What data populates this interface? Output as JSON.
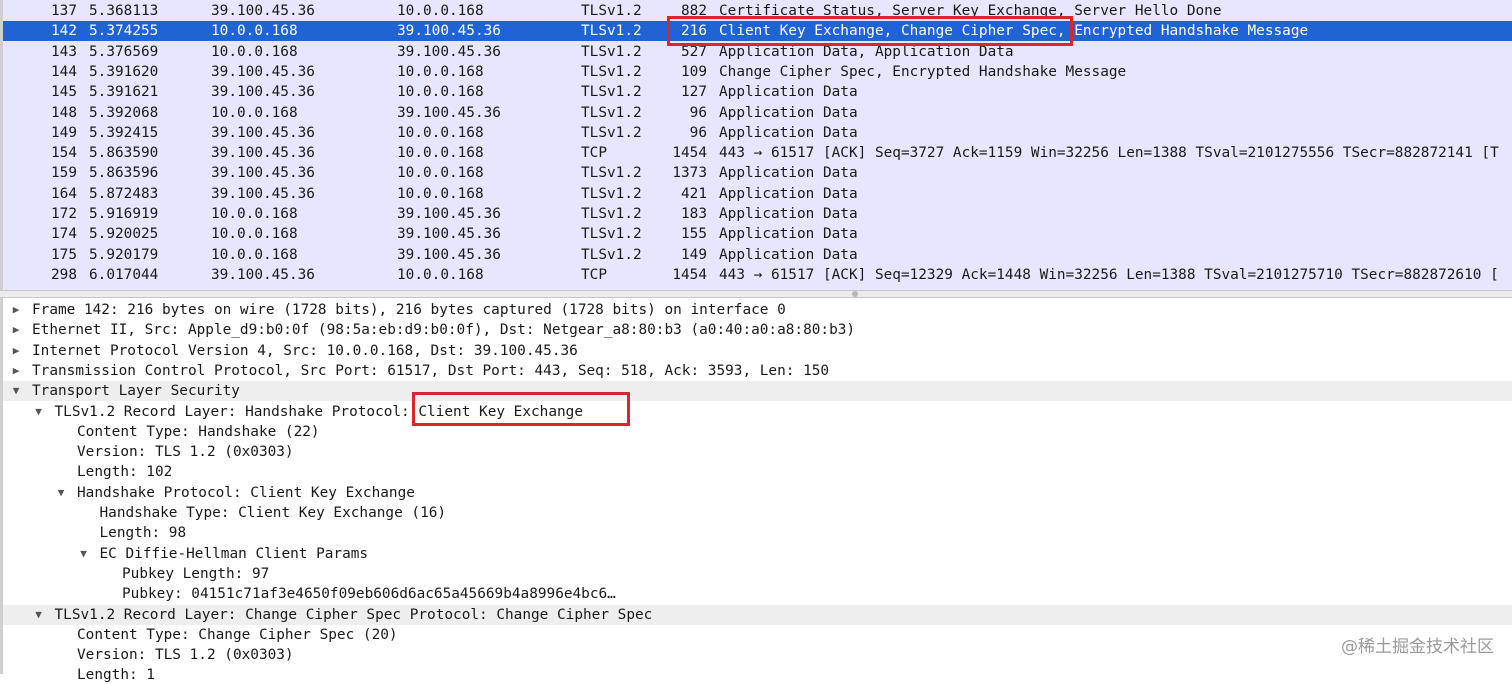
{
  "packets": [
    {
      "no": "137",
      "time": "5.368113",
      "src": "39.100.45.36",
      "dst": "10.0.0.168",
      "proto": "TLSv1.2",
      "len": "882",
      "info": "Certificate Status, Server Key Exchange, Server Hello Done"
    },
    {
      "no": "142",
      "time": "5.374255",
      "src": "10.0.0.168",
      "dst": "39.100.45.36",
      "proto": "TLSv1.2",
      "len": "216",
      "info": "Client Key Exchange, Change Cipher Spec, Encrypted Handshake Message"
    },
    {
      "no": "143",
      "time": "5.376569",
      "src": "10.0.0.168",
      "dst": "39.100.45.36",
      "proto": "TLSv1.2",
      "len": "527",
      "info": "Application Data, Application Data"
    },
    {
      "no": "144",
      "time": "5.391620",
      "src": "39.100.45.36",
      "dst": "10.0.0.168",
      "proto": "TLSv1.2",
      "len": "109",
      "info": "Change Cipher Spec, Encrypted Handshake Message"
    },
    {
      "no": "145",
      "time": "5.391621",
      "src": "39.100.45.36",
      "dst": "10.0.0.168",
      "proto": "TLSv1.2",
      "len": "127",
      "info": "Application Data"
    },
    {
      "no": "148",
      "time": "5.392068",
      "src": "10.0.0.168",
      "dst": "39.100.45.36",
      "proto": "TLSv1.2",
      "len": "96",
      "info": "Application Data"
    },
    {
      "no": "149",
      "time": "5.392415",
      "src": "39.100.45.36",
      "dst": "10.0.0.168",
      "proto": "TLSv1.2",
      "len": "96",
      "info": "Application Data"
    },
    {
      "no": "154",
      "time": "5.863590",
      "src": "39.100.45.36",
      "dst": "10.0.0.168",
      "proto": "TCP",
      "len": "1454",
      "info": "443 → 61517 [ACK] Seq=3727 Ack=1159 Win=32256 Len=1388 TSval=2101275556 TSecr=882872141 [T"
    },
    {
      "no": "159",
      "time": "5.863596",
      "src": "39.100.45.36",
      "dst": "10.0.0.168",
      "proto": "TLSv1.2",
      "len": "1373",
      "info": "Application Data"
    },
    {
      "no": "164",
      "time": "5.872483",
      "src": "39.100.45.36",
      "dst": "10.0.0.168",
      "proto": "TLSv1.2",
      "len": "421",
      "info": "Application Data"
    },
    {
      "no": "172",
      "time": "5.916919",
      "src": "10.0.0.168",
      "dst": "39.100.45.36",
      "proto": "TLSv1.2",
      "len": "183",
      "info": "Application Data"
    },
    {
      "no": "174",
      "time": "5.920025",
      "src": "10.0.0.168",
      "dst": "39.100.45.36",
      "proto": "TLSv1.2",
      "len": "155",
      "info": "Application Data"
    },
    {
      "no": "175",
      "time": "5.920179",
      "src": "10.0.0.168",
      "dst": "39.100.45.36",
      "proto": "TLSv1.2",
      "len": "149",
      "info": "Application Data"
    },
    {
      "no": "298",
      "time": "6.017044",
      "src": "39.100.45.36",
      "dst": "10.0.0.168",
      "proto": "TCP",
      "len": "1454",
      "info": "443 → 61517 [ACK] Seq=12329 Ack=1448 Win=32256 Len=1388 TSval=2101275710 TSecr=882872610 ["
    }
  ],
  "details": [
    {
      "indent": 0,
      "state": "collapsed",
      "text": "Frame 142: 216 bytes on wire (1728 bits), 216 bytes captured (1728 bits) on interface 0"
    },
    {
      "indent": 0,
      "state": "collapsed",
      "text": "Ethernet II, Src: Apple_d9:b0:0f (98:5a:eb:d9:b0:0f), Dst: Netgear_a8:80:b3 (a0:40:a0:a8:80:b3)"
    },
    {
      "indent": 0,
      "state": "collapsed",
      "text": "Internet Protocol Version 4, Src: 10.0.0.168, Dst: 39.100.45.36"
    },
    {
      "indent": 0,
      "state": "collapsed",
      "text": "Transmission Control Protocol, Src Port: 61517, Dst Port: 443, Seq: 518, Ack: 3593, Len: 150"
    },
    {
      "indent": 0,
      "state": "expanded",
      "text": "Transport Layer Security",
      "alt": true
    },
    {
      "indent": 1,
      "state": "expanded",
      "text": "TLSv1.2 Record Layer: Handshake Protocol: Client Key Exchange"
    },
    {
      "indent": 2,
      "state": "leaf",
      "text": "Content Type: Handshake (22)"
    },
    {
      "indent": 2,
      "state": "leaf",
      "text": "Version: TLS 1.2 (0x0303)"
    },
    {
      "indent": 2,
      "state": "leaf",
      "text": "Length: 102"
    },
    {
      "indent": 2,
      "state": "expanded",
      "text": "Handshake Protocol: Client Key Exchange"
    },
    {
      "indent": 3,
      "state": "leaf",
      "text": "Handshake Type: Client Key Exchange (16)"
    },
    {
      "indent": 3,
      "state": "leaf",
      "text": "Length: 98"
    },
    {
      "indent": 3,
      "state": "expanded",
      "text": "EC Diffie-Hellman Client Params"
    },
    {
      "indent": 4,
      "state": "leaf",
      "text": "Pubkey Length: 97"
    },
    {
      "indent": 4,
      "state": "leaf",
      "text": "Pubkey: 04151c71af3e4650f09eb606d6ac65a45669b4a8996e4bc6…"
    },
    {
      "indent": 1,
      "state": "expanded",
      "text": "TLSv1.2 Record Layer: Change Cipher Spec Protocol: Change Cipher Spec",
      "alt": true
    },
    {
      "indent": 2,
      "state": "leaf",
      "text": "Content Type: Change Cipher Spec (20)"
    },
    {
      "indent": 2,
      "state": "leaf",
      "text": "Version: TLS 1.2 (0x0303)"
    },
    {
      "indent": 2,
      "state": "leaf",
      "text": "Length: 1"
    }
  ],
  "icons": {
    "collapsed": "▶",
    "expanded": "▼",
    "leaf": ""
  },
  "colors": {
    "list_bg": "#e7e6ff",
    "selected": "#1f63d4",
    "annotation": "#d9262c"
  },
  "watermark": "@稀土掘金技术社区"
}
